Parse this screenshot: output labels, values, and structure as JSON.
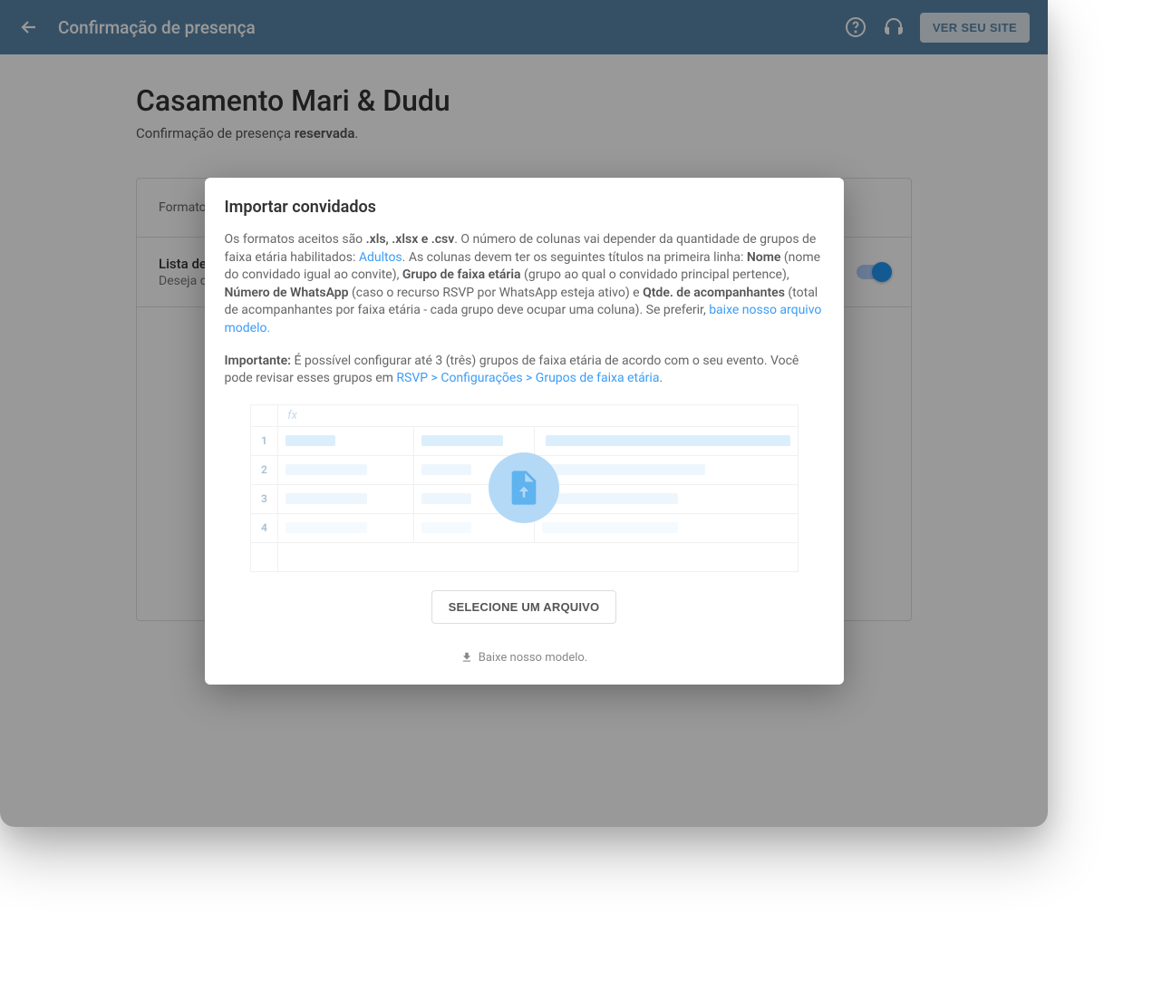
{
  "topbar": {
    "title": "Confirmação de presença",
    "view_site": "VER SEU SITE"
  },
  "page": {
    "title": "Casamento Mari & Dudu",
    "subtitle_prefix": "Confirmação de presença ",
    "subtitle_bold": "reservada",
    "subtitle_suffix": "."
  },
  "panel": {
    "format_label": "Formato",
    "pub_title": "Lista de p",
    "pub_desc": "Deseja que "
  },
  "modal": {
    "title": "Importar convidados",
    "p1_a": "Os formatos aceitos são ",
    "p1_b": ".xls, .xlsx e .csv",
    "p1_c": ". O número de colunas vai depender da quantidade de grupos de faixa etária habilitados: ",
    "p1_link1": "Adultos",
    "p1_d": ". As colunas devem ter os seguintes títulos na primeira linha: ",
    "p1_e": "Nome",
    "p1_f": " (nome do convidado igual ao convite), ",
    "p1_g": "Grupo de faixa etária",
    "p1_h": " (grupo ao qual o convidado principal pertence), ",
    "p1_i": "Número de WhatsApp",
    "p1_j": " (caso o recurso RSVP por WhatsApp esteja ativo) e ",
    "p1_k": "Qtde. de acompanhantes",
    "p1_l": " (total de acompanhantes por faixa etária - cada grupo deve ocupar uma coluna). Se preferir, ",
    "p1_link2": "baixe nosso arquivo modelo.",
    "p2_a": "Importante:",
    "p2_b": " É possível configurar até 3 (três) grupos de faixa etária de acordo com o seu evento. Você pode revisar esses grupos em ",
    "p2_link": "RSVP > Configurações > Grupos de faixa etária",
    "p2_c": ".",
    "sheet_rows": [
      "1",
      "2",
      "3",
      "4"
    ],
    "fx_label": "fx",
    "select_file": "SELECIONE UM ARQUIVO",
    "download_model": "Baixe nosso modelo."
  }
}
